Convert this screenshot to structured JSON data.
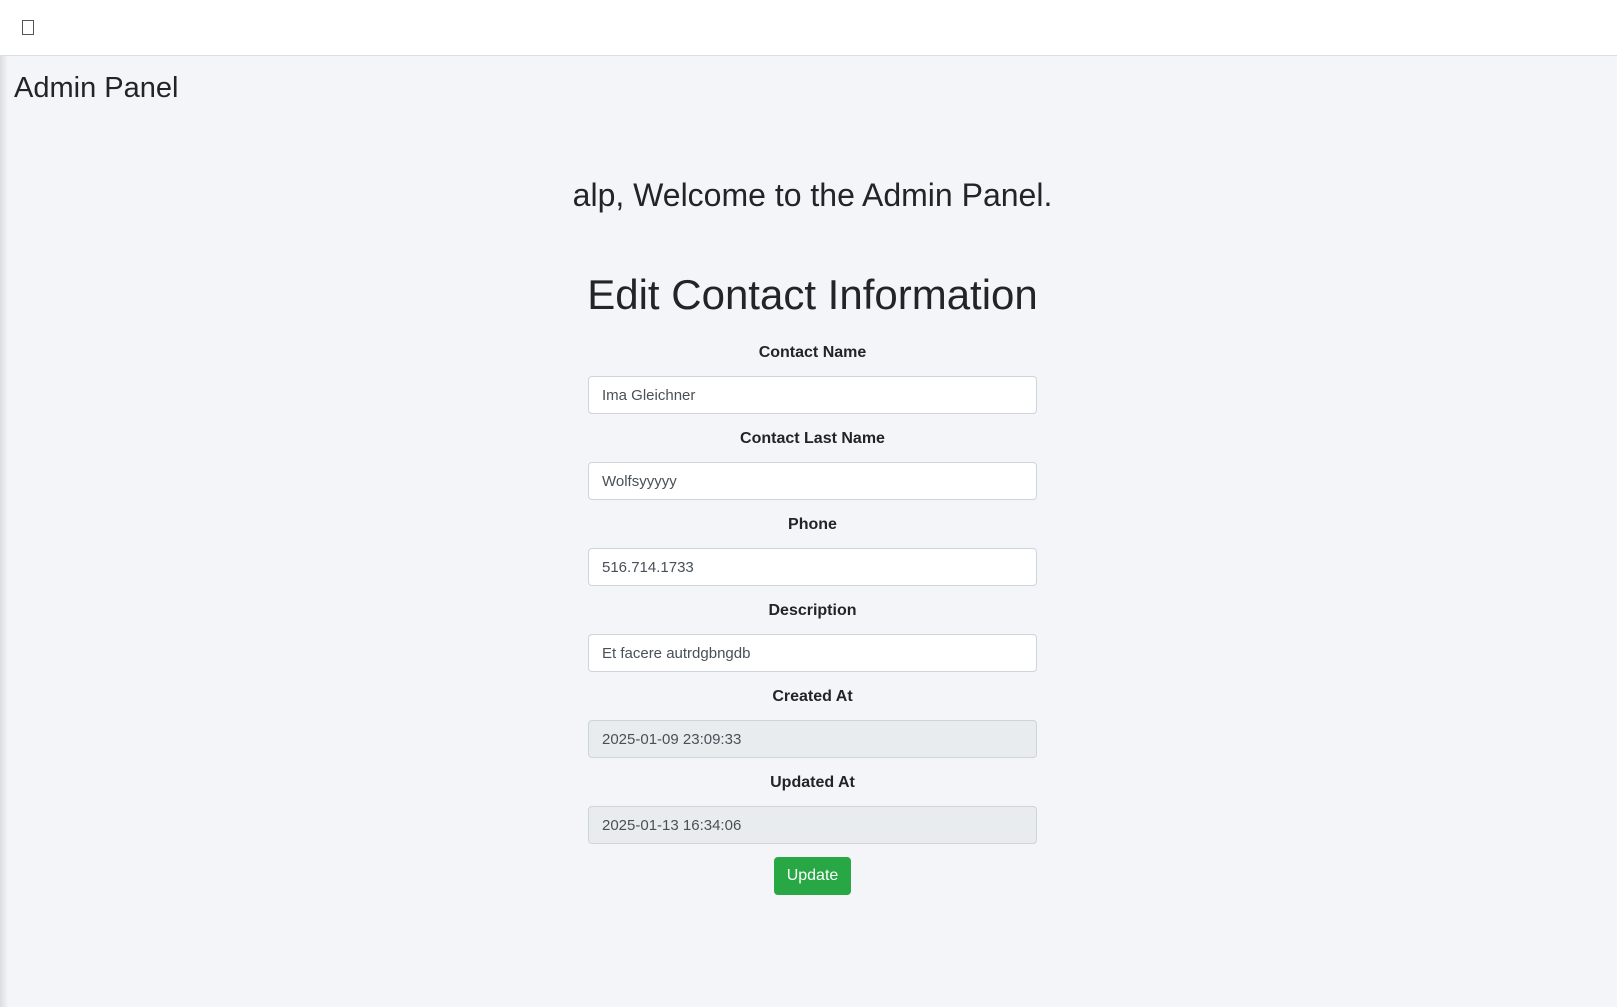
{
  "topbar": {
    "menu_icon": "menu-toggle-icon"
  },
  "brand": {
    "title": "Admin Panel"
  },
  "welcome": {
    "text": "alp, Welcome to the Admin Panel."
  },
  "form": {
    "title": "Edit Contact Information",
    "fields": [
      {
        "label": "Contact Name",
        "value": "Ima Gleichner"
      },
      {
        "label": "Contact Last Name",
        "value": "Wolfsyyyyy"
      },
      {
        "label": "Phone",
        "value": "516.714.1733"
      },
      {
        "label": "Description",
        "value": "Et facere autrdgbngdb"
      },
      {
        "label": "Created At",
        "value": "2025-01-09 23:09:33"
      },
      {
        "label": "Updated At",
        "value": "2025-01-13 16:34:06"
      }
    ],
    "submit_label": "Update"
  },
  "colors": {
    "background": "#f4f5f8",
    "primary_action": "#28a745",
    "readonly_field": "#e9ecef"
  }
}
